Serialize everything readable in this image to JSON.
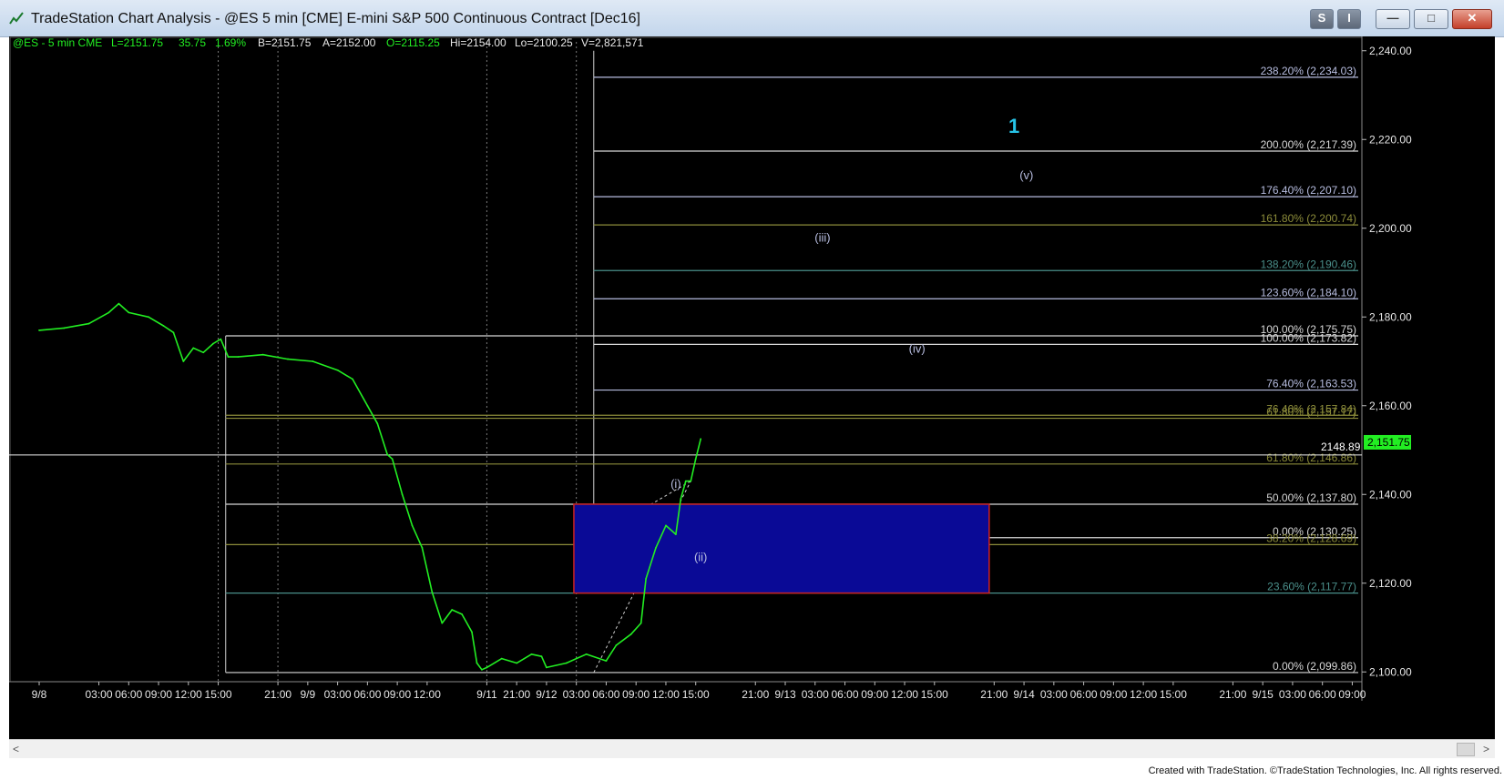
{
  "window": {
    "title": "TradeStation Chart Analysis - @ES 5 min [CME] E-mini S&P 500 Continuous Contract [Dec16]",
    "buttons": {
      "s": "S",
      "i": "I",
      "minimize": "—",
      "maximize": "□",
      "close": "✕"
    }
  },
  "status_line": {
    "symbol": "@ES - 5 min  CME",
    "last": "L=2151.75",
    "change": "35.75",
    "pct": "1.69%",
    "bid": "B=2151.75",
    "ask": "A=2152.00",
    "open": "O=2115.25",
    "high": "Hi=2154.00",
    "low": "Lo=2100.25",
    "volume": "V=2,821,571"
  },
  "footer": "Created with TradeStation. ©TradeStation Technologies, Inc. All rights reserved.",
  "colors": {
    "background": "#000000",
    "price": "#22ee22",
    "white_level": "#d8d8d8",
    "olive_level": "#8c8c3a",
    "teal_level": "#4a8f8a",
    "lilac_level": "#b7bde0",
    "box_fill": "#0a0a96",
    "box_border": "#cc2222",
    "wave_label": "#b7bde0",
    "wave_1": "#27c3e6"
  },
  "chart_data": {
    "type": "line",
    "title": "",
    "y_axis": {
      "range": [
        2098,
        2242
      ],
      "ticks": [
        "2,240.00",
        "2,220.00",
        "2,200.00",
        "2,180.00",
        "2,160.00",
        "2,140.00",
        "2,120.00",
        "2,100.00"
      ],
      "tick_values": [
        2240,
        2220,
        2200,
        2180,
        2160,
        2140,
        2120,
        2100
      ],
      "current_price_label": "2,151.75",
      "current_price": 2151.75
    },
    "x_axis": {
      "ticks": [
        "9/8",
        "03:00",
        "06:00",
        "09:00",
        "12:00",
        "15:00",
        "21:00",
        "9/9",
        "03:00",
        "06:00",
        "09:00",
        "12:00",
        "9/11",
        "21:00",
        "9/12",
        "03:00",
        "06:00",
        "09:00",
        "12:00",
        "15:00",
        "21:00",
        "9/13",
        "03:00",
        "06:00",
        "09:00",
        "12:00",
        "15:00",
        "21:00",
        "9/14",
        "03:00",
        "06:00",
        "09:00",
        "12:00",
        "15:00",
        "21:00",
        "9/15",
        "03:00",
        "06:00",
        "09:00"
      ],
      "tick_index": [
        0,
        24,
        36,
        48,
        60,
        72,
        96,
        108,
        120,
        132,
        144,
        156,
        180,
        192,
        204,
        216,
        228,
        240,
        252,
        264,
        288,
        300,
        312,
        324,
        336,
        348,
        360,
        384,
        396,
        408,
        420,
        432,
        444,
        456,
        480,
        492,
        504,
        516,
        528
      ],
      "session_dividers": [
        72,
        96,
        180,
        216
      ]
    },
    "series": [
      {
        "values_index": [
          0,
          10,
          20,
          28,
          32,
          36,
          44,
          50,
          54,
          58,
          62,
          66,
          70,
          73,
          76,
          80,
          90,
          100,
          110,
          120,
          126,
          132,
          136,
          140,
          142,
          146,
          150,
          154,
          158,
          162,
          166,
          170,
          174,
          176,
          178,
          180,
          186,
          192,
          198,
          202,
          204,
          212,
          220,
          228,
          232,
          238,
          242,
          244,
          248,
          252,
          256,
          258,
          260,
          262,
          264,
          266
        ],
        "values": [
          2177,
          2177.5,
          2178.5,
          2181,
          2183,
          2181,
          2180,
          2178,
          2176.5,
          2170,
          2173,
          2172,
          2174,
          2175,
          2171,
          2171,
          2171.5,
          2170.5,
          2170,
          2168,
          2166,
          2160,
          2156,
          2149,
          2148,
          2140,
          2133,
          2128,
          2118,
          2111,
          2114,
          2113,
          2109,
          2102,
          2100.5,
          2101,
          2103,
          2102,
          2104,
          2103.5,
          2101,
          2102,
          2104,
          2102.5,
          2106,
          2108.5,
          2111,
          2121,
          2128,
          2133,
          2131,
          2139,
          2143,
          2143,
          2148,
          2152.5
        ]
      }
    ],
    "fib_levels": [
      {
        "label": "238.20% (2,234.03)",
        "value": 2234.03,
        "color": "lilac",
        "from_index": 223
      },
      {
        "label": "200.00% (2,217.39)",
        "value": 2217.39,
        "color": "white",
        "from_index": 223
      },
      {
        "label": "176.40% (2,207.10)",
        "value": 2207.1,
        "color": "lilac",
        "from_index": 223
      },
      {
        "label": "161.80% (2,200.74)",
        "value": 2200.74,
        "color": "olive",
        "from_index": 223
      },
      {
        "label": "138.20% (2,190.46)",
        "value": 2190.46,
        "color": "teal",
        "from_index": 223
      },
      {
        "label": "123.60% (2,184.10)",
        "value": 2184.1,
        "color": "lilac",
        "from_index": 223
      },
      {
        "label": "100.00% (2,175.75)",
        "value": 2175.75,
        "color": "white",
        "from_index": 75
      },
      {
        "label": "100.00% (2,173.82)",
        "value": 2173.82,
        "color": "white",
        "from_index": 223
      },
      {
        "label": "76.40% (2,163.53)",
        "value": 2163.53,
        "color": "lilac",
        "from_index": 223
      },
      {
        "label": "76.40% (2,157.84)",
        "value": 2157.84,
        "color": "olive",
        "from_index": 75
      },
      {
        "label": "61.80% (2,157.17)",
        "value": 2157.17,
        "color": "olive",
        "from_index": 75
      },
      {
        "label": "61.80% (2,146.86)",
        "value": 2146.86,
        "color": "olive",
        "from_index": 75
      },
      {
        "label": "50.00% (2,137.80)",
        "value": 2137.8,
        "color": "white",
        "from_index": 75
      },
      {
        "label": "0.00% (2,130.25)",
        "value": 2130.25,
        "color": "white",
        "from_index": 223
      },
      {
        "label": "38.20% (2,128.69)",
        "value": 2128.69,
        "color": "olive",
        "from_index": 75
      },
      {
        "label": "23.60% (2,117.77)",
        "value": 2117.77,
        "color": "teal",
        "from_index": 75
      },
      {
        "label": "0.00% (2,099.86)",
        "value": 2099.86,
        "color": "white",
        "from_index": 75
      }
    ],
    "horizontal_marker": {
      "value": 2148.89,
      "label": "2148.89"
    },
    "target_box": {
      "from_index": 215,
      "to_index": 382,
      "top": 2137.8,
      "bottom": 2117.77
    },
    "vertical_guides": [
      {
        "index": 223,
        "top": 2240,
        "bottom": 2130.25
      },
      {
        "index": 75,
        "top": 2175.75,
        "bottom": 2099.86
      }
    ],
    "wave_labels": [
      {
        "text": "1",
        "index": 392,
        "value": 2221.5,
        "big": true
      },
      {
        "text": "(v)",
        "index": 397,
        "value": 2211
      },
      {
        "text": "(iii)",
        "index": 315,
        "value": 2197
      },
      {
        "text": "(iv)",
        "index": 353,
        "value": 2172
      },
      {
        "text": "(i)",
        "index": 256,
        "value": 2141.5
      },
      {
        "text": "(ii)",
        "index": 266,
        "value": 2125
      }
    ],
    "dashed_channel": [
      [
        223,
        2099.86
      ],
      [
        262,
        2143
      ],
      [
        223,
        2130.25
      ],
      [
        262,
        2143
      ]
    ]
  }
}
